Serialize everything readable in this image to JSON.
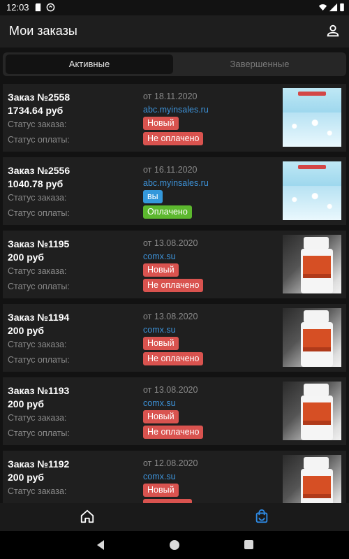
{
  "status_bar": {
    "time": "12:03",
    "icons": [
      "sd-card-icon",
      "sync-icon",
      "wifi-icon",
      "signal-icon",
      "battery-icon"
    ]
  },
  "header": {
    "title": "Мои заказы",
    "profile_icon": "person-icon"
  },
  "tabs": [
    {
      "label": "Активные",
      "active": true
    },
    {
      "label": "Завершенные",
      "active": false
    }
  ],
  "labels": {
    "order_status": "Статус заказа:",
    "payment_status": "Статус оплаты:"
  },
  "orders": [
    {
      "title": "Заказ №2558",
      "sum": "1734.64 руб",
      "date": "от 18.11.2020",
      "site": "abc.myinsales.ru",
      "status": "Новый",
      "payment": "Не оплачено",
      "thumb": "snow-banner"
    },
    {
      "title": "Заказ №2556",
      "sum": "1040.78 руб",
      "date": "от 16.11.2020",
      "site": "abc.myinsales.ru",
      "status": "вы",
      "payment": "Оплачено",
      "thumb": "snow-banner"
    },
    {
      "title": "Заказ №1195",
      "sum": "200 руб",
      "date": "от 13.08.2020",
      "site": "comx.su",
      "status": "Новый",
      "payment": "Не оплачено",
      "thumb": "bottle"
    },
    {
      "title": "Заказ №1194",
      "sum": "200 руб",
      "date": "от 13.08.2020",
      "site": "comx.su",
      "status": "Новый",
      "payment": "Не оплачено",
      "thumb": "bottle"
    },
    {
      "title": "Заказ №1193",
      "sum": "200 руб",
      "date": "от 13.08.2020",
      "site": "comx.su",
      "status": "Новый",
      "payment": "Не оплачено",
      "thumb": "bottle"
    },
    {
      "title": "Заказ №1192",
      "sum": "200 руб",
      "date": "от 12.08.2020",
      "site": "comx.su",
      "status": "Новый",
      "payment": "",
      "thumb": "bottle"
    }
  ],
  "colors": {
    "status_new": "#d9534f",
    "status_other": "#3498db",
    "not_paid": "#d9534f",
    "paid": "#5cb82e",
    "link": "#3d92d8",
    "nav_active": "#2e8be6"
  },
  "bottom_nav": {
    "items": [
      {
        "icon": "home-icon",
        "active": false
      },
      {
        "icon": "shopping-bag-icon",
        "active": true
      }
    ]
  },
  "system_nav": [
    "back-icon",
    "home-circle-icon",
    "recent-apps-icon"
  ]
}
